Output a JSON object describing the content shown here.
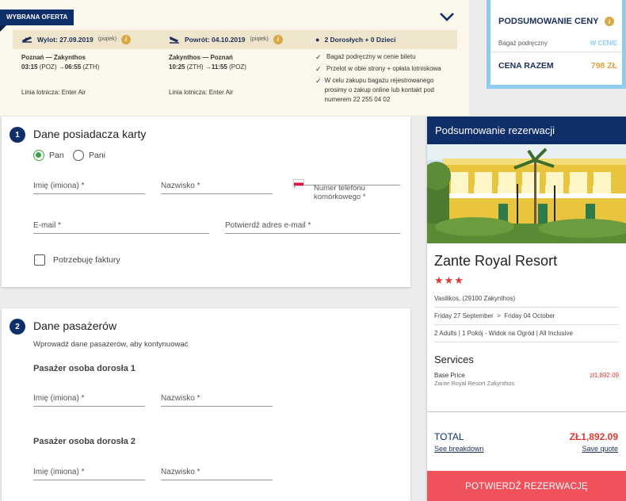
{
  "offer": {
    "badge": "WYBRANA OFERTA",
    "outbound": {
      "header": "Wylot: 27.09.2019",
      "day": "(piątek)",
      "route": "Poznań — Zakynthos",
      "time_dep": "03:15",
      "code_dep": "(POZ)",
      "arrow": "→",
      "time_arr": "06:55",
      "code_arr": "(ZTH)",
      "airline": "Linia lotnicza: Enter Air"
    },
    "return": {
      "header": "Powrót: 04.10.2019",
      "day": "(piątek)",
      "route": "Zakynthos — Poznań",
      "time_dep": "10:25",
      "code_dep": "(ZTH)",
      "arrow": "→",
      "time_arr": "11:55",
      "code_arr": "(POZ)",
      "airline": "Linia lotnicza: Enter Air"
    },
    "passengers": {
      "header": "2 Dorosłych + 0 Dzieci",
      "checks": [
        "Bagaż podręczny w cenie biletu",
        "Przelot w obie strony + opłata lotniskowa",
        "W celu zakupu bagażu rejestrowanego prosimy o zakup online lub kontakt pod numerem 22 255 04 02"
      ]
    }
  },
  "price_summary": {
    "title": "PODSUMOWANIE CENY",
    "hand_luggage_label": "Bagaż podręczny",
    "hand_luggage_value": "W CENIE",
    "total_label": "CENA RAZEM",
    "total_value": "798 ZŁ"
  },
  "card_holder": {
    "step": "1",
    "title": "Dane posiadacza karty",
    "radio_pan": "Pan",
    "radio_pani": "Pani",
    "first_name": "Imię (imiona) *",
    "last_name": "Nazwisko *",
    "phone": "Numer telefonu komórkowego *",
    "email": "E-mail *",
    "email_confirm": "Potwierdź adres e-mail *",
    "invoice": "Potrzebuję faktury"
  },
  "passengers_card": {
    "step": "2",
    "title": "Dane pasażerów",
    "subtitle": "Wprowadź dane pasażerów, aby kontynuować",
    "adult1": "Pasażer osoba dorosła 1",
    "adult2": "Pasażer osoba dorosła 2",
    "first_name": "Imię (imiona) *",
    "last_name": "Nazwisko *"
  },
  "reservation": {
    "header": "Podsumowanie rezerwacji",
    "hotel_name": "Zante Royal Resort",
    "stars": "★★★",
    "address": "Vasilikos, (29100 Zakynthos)",
    "date_from": "Friday 27 September",
    "date_sep": ">",
    "date_to": "Friday 04 October",
    "room": "2 Adults | 1 Pokój - Widok na Ogród | All Inclusive",
    "services_title": "Services",
    "base_price_label": "Base Price",
    "base_price_value": "zł1,892.09",
    "base_price_sub": "Zante Royal Resort Zakynthos",
    "total_label": "TOTAL",
    "total_value": "ZŁ1,892.09",
    "breakdown_link": "See breakdown",
    "save_link": "Save quote",
    "confirm_button": "POTWIERDŹ REZERWACJĘ"
  },
  "colors": {
    "navy": "#0f2f6b",
    "accent_red": "#f0525c",
    "gold": "#e0a33b",
    "light_blue": "#8fcdf0",
    "offer_bg": "#fbf7ea"
  }
}
